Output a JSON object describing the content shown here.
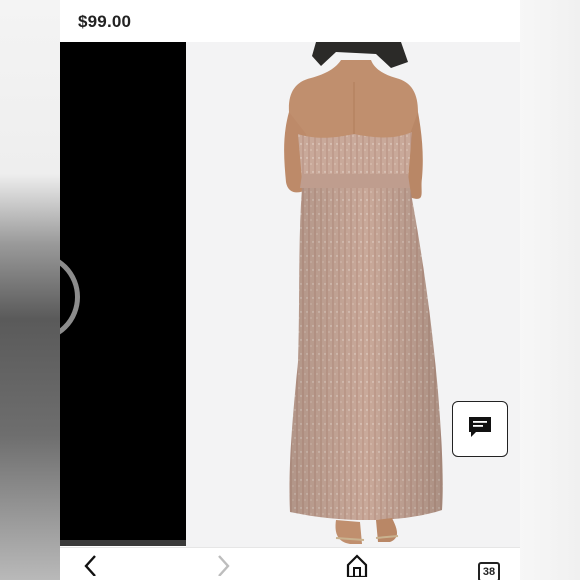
{
  "product": {
    "price": "$99.00"
  },
  "navigation": {
    "tab_count": "38"
  },
  "icons": {
    "chat": "chat-bubble-icon",
    "back": "chevron-left-icon",
    "forward": "chevron-right-icon",
    "home": "home-icon",
    "tabs": "tabs-icon"
  },
  "colors": {
    "dress": "#c9a99a",
    "skin": "#c08f6e",
    "hair": "#2b2a28"
  }
}
